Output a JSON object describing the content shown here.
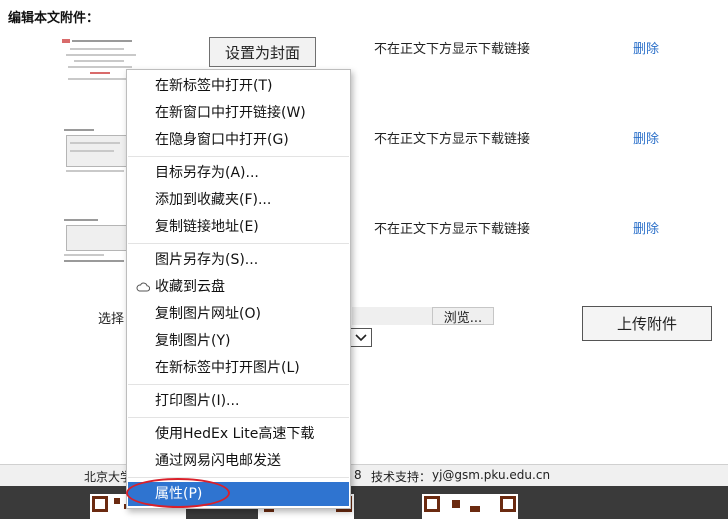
{
  "section": {
    "title": "编辑本文附件："
  },
  "attachments": [
    {
      "status": "不在正文下方显示下载链接",
      "delete": "删除"
    },
    {
      "status": "不在正文下方显示下载链接",
      "delete": "删除"
    },
    {
      "status": "不在正文下方显示下载链接",
      "delete": "删除"
    }
  ],
  "toolbar": {
    "set_cover": "设置为封面",
    "choose_label": "选择",
    "browse": "浏览...",
    "upload": "上传附件"
  },
  "footer": {
    "left_text": "北京大学",
    "mid_text": "8",
    "support_label": "技术支持：",
    "support_email": "yj@gsm.pku.edu.cn"
  },
  "context_menu": {
    "items": [
      "在新标签中打开(T)",
      "在新窗口中打开链接(W)",
      "在隐身窗口中打开(G)",
      "目标另存为(A)...",
      "添加到收藏夹(F)...",
      "复制链接地址(E)",
      "图片另存为(S)...",
      "收藏到云盘",
      "复制图片网址(O)",
      "复制图片(Y)",
      "在新标签中打开图片(L)",
      "打印图片(I)...",
      "使用HedEx Lite高速下载",
      "通过网易闪电邮发送",
      "属性(P)"
    ]
  },
  "colors": {
    "link": "#2a6fc9",
    "menu_highlight": "#2f74d0",
    "annotation": "#d9202a"
  }
}
